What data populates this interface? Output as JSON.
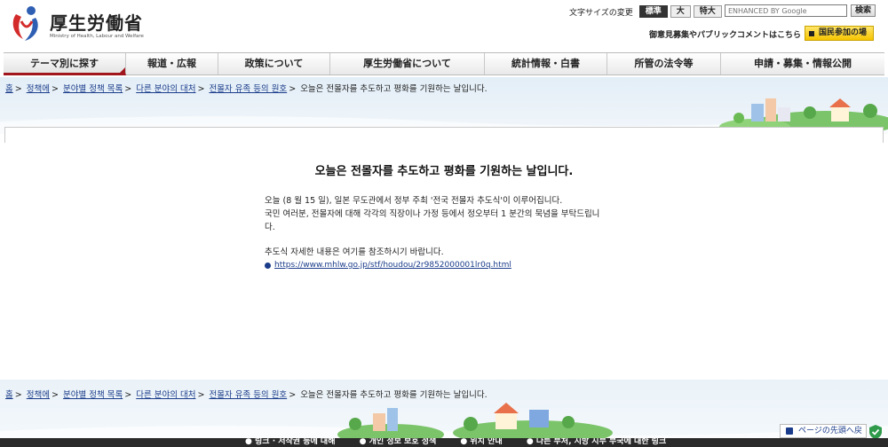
{
  "header": {
    "logo_title": "厚生労働省",
    "logo_subtitle": "Ministry of Health, Labour and Welfare",
    "font_size_label": "文字サイズの変更",
    "font_sizes": [
      "標準",
      "大",
      "特大"
    ],
    "search_placeholder": "ENHANCED BY Google",
    "search_button": "検索",
    "comment_link": "御意見募集やパブリックコメントはこちら",
    "participation_button": "国民参加の場"
  },
  "nav": {
    "items": [
      "テーマ別に探す",
      "報道・広報",
      "政策について",
      "厚生労働省について",
      "統計情報・白書",
      "所管の法令等",
      "申請・募集・情報公開"
    ]
  },
  "breadcrumb": {
    "items": [
      "홈",
      "정책에",
      "분야별 정책 목록",
      "다른 분야의 대처",
      "전몰자 유족 등의 원호"
    ],
    "current": "오늘은 전몰자를 추도하고 평화를 기원하는 날입니다."
  },
  "main": {
    "title": "오늘은 전몰자를 추도하고 평화를 기원하는 날입니다.",
    "paragraph1_line1": "오늘 (8 월 15 일), 일본 무도관에서 정부 주최 '전국 전몰자 추도식'이 이루어집니다.",
    "paragraph1_line2": "국민 여러분, 전몰자에 대해 각각의 직장이나 가정 등에서 정오부터 1 분간의 묵념을 부탁드립니",
    "paragraph1_line3": "다.",
    "paragraph2": "추도식 자세한 내용은 여기를 참조하시기 바랍니다.",
    "link_text": "https://www.mhlw.go.jp/stf/houdou/2r9852000001lr0q.html"
  },
  "footer": {
    "links": [
      "링크 · 저작권 등에 대해",
      "개인 정보 보호 정책",
      "위치 안내",
      "다른 부처, 지방 지부 부국에 대한 링크"
    ],
    "page_top": "ページの先頭へ戻る"
  }
}
